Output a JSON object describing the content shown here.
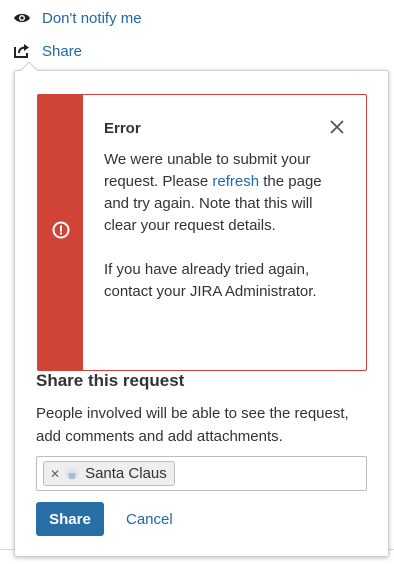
{
  "top_links": {
    "notify_label": "Don't notify me",
    "share_label": "Share"
  },
  "error": {
    "title": "Error",
    "message_before_link": "We were unable to submit your request. Please ",
    "refresh_link": "refresh",
    "message_after_link": " the page and try again. Note that this will clear your request details.",
    "message_second": "If you have already tried again, contact your JIRA Administrator."
  },
  "share": {
    "heading": "Share this request",
    "description": "People involved will be able to see the request, add comments and add attachments.",
    "users": [
      {
        "name": "Santa Claus"
      }
    ],
    "share_button": "Share",
    "cancel_link": "Cancel"
  },
  "icons": {
    "notify": "eye-icon",
    "share": "share-icon",
    "error": "warning-circle-icon",
    "close": "close-icon",
    "remove_chip": "remove-icon",
    "avatar": "avatar-icon"
  },
  "colors": {
    "link": "#2168a8",
    "error_red": "#d04437",
    "primary_button": "#2a6ea6"
  }
}
